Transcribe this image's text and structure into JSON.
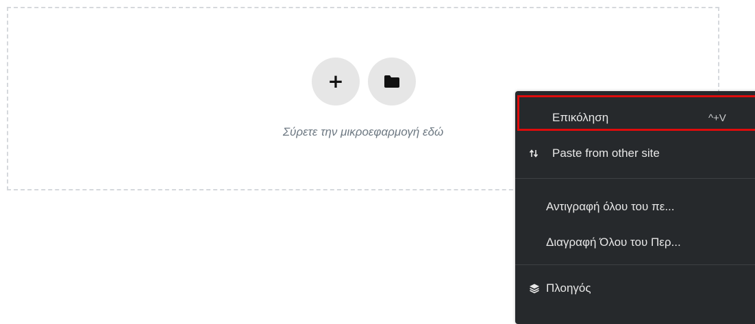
{
  "dropzone": {
    "drag_text": "Σύρετε την μικροεφαρμογή εδώ",
    "add_label": "+"
  },
  "context_menu": {
    "items": [
      {
        "label": "Επικόληση",
        "shortcut": "^+V",
        "highlighted": true
      },
      {
        "label": "Paste from other site",
        "icon": "paste-arrows-icon"
      },
      {
        "label": "Αντιγραφή όλου του πε..."
      },
      {
        "label": "Διαγραφή Όλου του Περ..."
      },
      {
        "label": "Πλοηγός",
        "icon": "layers-icon"
      }
    ]
  },
  "colors": {
    "menu_background": "#26292c",
    "highlight_border": "#e00b0b",
    "button_background": "#e6e6e6",
    "dropzone_border": "#d5d8dc"
  }
}
